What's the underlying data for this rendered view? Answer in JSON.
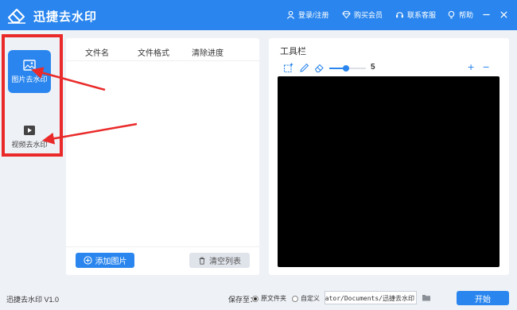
{
  "app": {
    "title": "迅捷去水印"
  },
  "titlebar": {
    "login": "登录/注册",
    "vip": "购买会员",
    "service": "联系客服",
    "help": "帮助"
  },
  "sidebar": {
    "items": [
      {
        "label": "图片去水印",
        "icon": "image-icon",
        "active": true
      },
      {
        "label": "视频去水印",
        "icon": "video-play-icon",
        "active": false
      }
    ]
  },
  "filelist": {
    "columns": [
      "文件名",
      "文件格式",
      "清除进度"
    ],
    "add_label": "添加图片",
    "clear_label": "清空列表"
  },
  "toolbar": {
    "title": "工具栏",
    "brush_size": "5",
    "brush_fraction": 0.45,
    "zoom_in": "+",
    "zoom_out": "−"
  },
  "status": {
    "version": "迅捷去水印 V1.0",
    "save_to": "保存至：",
    "option_original": "原文件夹",
    "option_custom": "自定义",
    "path": "istrator/Documents/迅捷去水印",
    "start": "开始"
  },
  "colors": {
    "accent": "#2a86ee",
    "highlight": "#ea2a2a",
    "canvas": "#000000"
  }
}
